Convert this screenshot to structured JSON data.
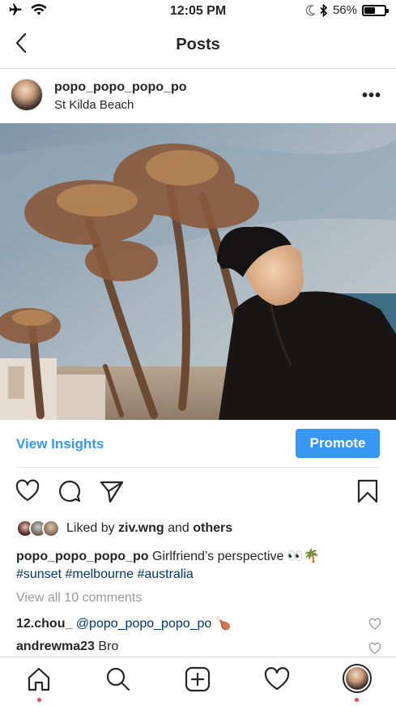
{
  "status_bar": {
    "time": "12:05 PM",
    "battery_percent": "56%",
    "battery_level": 0.56
  },
  "nav": {
    "title": "Posts"
  },
  "post": {
    "username": "popo_popo_popo_po",
    "location": "St Kilda Beach",
    "more_label": "•••",
    "insights_label": "View Insights",
    "promote_label": "Promote",
    "likes": {
      "prefix": "Liked by",
      "user": "ziv.wng",
      "conj": "and",
      "others": "others"
    },
    "caption": {
      "user": "popo_popo_popo_po",
      "text": "Girlfriend’s perspective 👀🌴",
      "hashtags": [
        "#sunset",
        "#melbourne",
        "#australia"
      ]
    },
    "view_all_comments": "View all 10 comments",
    "comments": [
      {
        "user": "12.chou_",
        "mention": "@popo_popo_popo_po",
        "text": "🍗"
      },
      {
        "user": "andrewma23",
        "mention": "",
        "text": "Bro"
      }
    ]
  },
  "icons": {
    "status_left": [
      "airplane-icon",
      "wifi-icon"
    ],
    "status_right": [
      "moon-icon",
      "bluetooth-icon",
      "battery-icon"
    ],
    "actions": [
      "heart-icon",
      "comment-icon",
      "share-icon",
      "bookmark-icon"
    ],
    "tabs": [
      "home-icon",
      "search-icon",
      "add-post-icon",
      "activity-heart-icon",
      "profile-avatar"
    ]
  },
  "colors": {
    "accent": "#3897f0",
    "hashtag": "#003569",
    "notification_dot": "#ed4956",
    "muted": "#999999"
  }
}
